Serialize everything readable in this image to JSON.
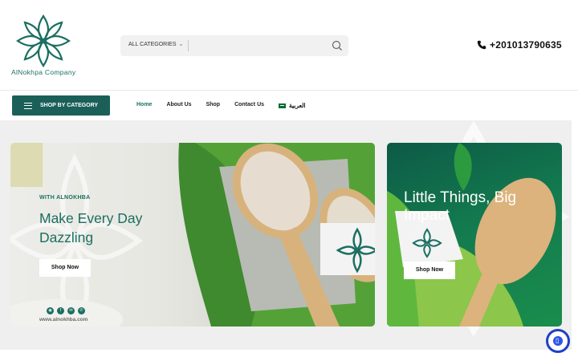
{
  "header": {
    "logo_text": "AlNokhpa Company",
    "search": {
      "category_label": "ALL CATEGORIES",
      "input_value": "",
      "placeholder": ""
    },
    "phone": "+201013790635"
  },
  "nav": {
    "category_button": "SHOP BY CATEGORY",
    "links": [
      "Home",
      "About Us",
      "Shop",
      "Contact Us"
    ],
    "language": "العربية"
  },
  "hero": {
    "kicker": "WITH ALNOKHBA",
    "title": "Make Every Day Dazzling",
    "button": "Shop Now",
    "url": "www.alnokhba.com"
  },
  "side_banner": {
    "title": "Little Things, Big Impact",
    "button": "Shop Now"
  },
  "colors": {
    "brand": "#1b6f61",
    "category_button_bg": "#1b5f59",
    "side_banner_bg": "#137a4f",
    "chat_accent": "#1f3fc7"
  },
  "icons": {
    "search": "search-icon",
    "phone": "phone-icon",
    "menu": "hamburger-icon",
    "chat": "chat-icon",
    "flag": "flag-icon"
  }
}
